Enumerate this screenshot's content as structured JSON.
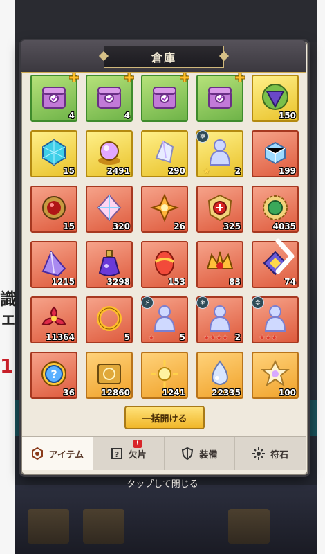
{
  "title": "倉庫",
  "open_all_label": "一括開ける",
  "close_hint": "タップして閉じる",
  "tabs": [
    {
      "label": "アイテム",
      "icon": "item-bag-icon",
      "active": true
    },
    {
      "label": "欠片",
      "icon": "shard-question-icon",
      "badge": "!"
    },
    {
      "label": "装備",
      "icon": "shield-icon"
    },
    {
      "label": "符石",
      "icon": "rune-sun-icon"
    }
  ],
  "background": {
    "left_text_1": "識ノ",
    "left_text_2": "ェ",
    "left_red_text": "1"
  },
  "items": [
    {
      "rarity": "green",
      "icon": "treasure-chest-icon",
      "count": "4",
      "plus": true
    },
    {
      "rarity": "green",
      "icon": "treasure-chest-icon",
      "count": "4",
      "plus": true
    },
    {
      "rarity": "green",
      "icon": "treasure-chest-icon",
      "count": "",
      "plus": true
    },
    {
      "rarity": "green",
      "icon": "treasure-chest-icon",
      "count": "",
      "plus": true
    },
    {
      "rarity": "yellow",
      "icon": "triangle-gem-icon",
      "count": "150"
    },
    {
      "rarity": "yellow",
      "icon": "blue-cube-icon",
      "count": "15"
    },
    {
      "rarity": "yellow",
      "icon": "rainbow-orb-icon",
      "count": "2491"
    },
    {
      "rarity": "yellow",
      "icon": "crystal-shard-icon",
      "count": "290"
    },
    {
      "rarity": "yellow",
      "icon": "hero-figure-icon",
      "count": "2",
      "stars": "★",
      "elem": "❄"
    },
    {
      "rarity": "red",
      "icon": "ice-cube-icon",
      "count": "199"
    },
    {
      "rarity": "red",
      "icon": "red-orb-icon",
      "count": "15"
    },
    {
      "rarity": "red",
      "icon": "rainbow-diamond-icon",
      "count": "320"
    },
    {
      "rarity": "red",
      "icon": "golden-star-gem-icon",
      "count": "26"
    },
    {
      "rarity": "red",
      "icon": "ruby-badge-icon",
      "count": "325"
    },
    {
      "rarity": "red",
      "icon": "green-gear-medal-icon",
      "count": "4035"
    },
    {
      "rarity": "red",
      "icon": "purple-crystal-icon",
      "count": "1215"
    },
    {
      "rarity": "red",
      "icon": "potion-bottle-icon",
      "count": "3298"
    },
    {
      "rarity": "red",
      "icon": "golden-egg-icon",
      "count": "153"
    },
    {
      "rarity": "red",
      "icon": "crown-emblem-icon",
      "count": "83"
    },
    {
      "rarity": "red",
      "icon": "gem-cluster-icon",
      "count": "74"
    },
    {
      "rarity": "red",
      "icon": "red-flower-gem-icon",
      "count": "11364"
    },
    {
      "rarity": "red",
      "icon": "golden-ring-icon",
      "count": "5"
    },
    {
      "rarity": "red",
      "icon": "hero-figure-icon",
      "count": "5",
      "stars": "★",
      "stars_red": true,
      "elem": "⚡"
    },
    {
      "rarity": "red",
      "icon": "hero-figure-icon",
      "count": "2",
      "stars": "★★★★",
      "stars_red": true,
      "elem": "❄"
    },
    {
      "rarity": "red",
      "icon": "hero-figure-icon",
      "count": "",
      "stars": "★★★",
      "stars_red": true,
      "elem": "✲"
    },
    {
      "rarity": "red",
      "icon": "mystery-coin-icon",
      "count": "36"
    },
    {
      "rarity": "orange",
      "icon": "golden-ticket-icon",
      "count": "12860"
    },
    {
      "rarity": "orange",
      "icon": "sun-emblem-icon",
      "count": "1241"
    },
    {
      "rarity": "orange",
      "icon": "water-drop-icon",
      "count": "22335"
    },
    {
      "rarity": "orange",
      "icon": "flower-crystal-icon",
      "count": "100"
    }
  ],
  "colors": {
    "green": "#6eb348",
    "yellow": "#e9c22a",
    "red": "#de5a3c",
    "orange": "#f0a22a",
    "accent": "#c9a64e"
  }
}
